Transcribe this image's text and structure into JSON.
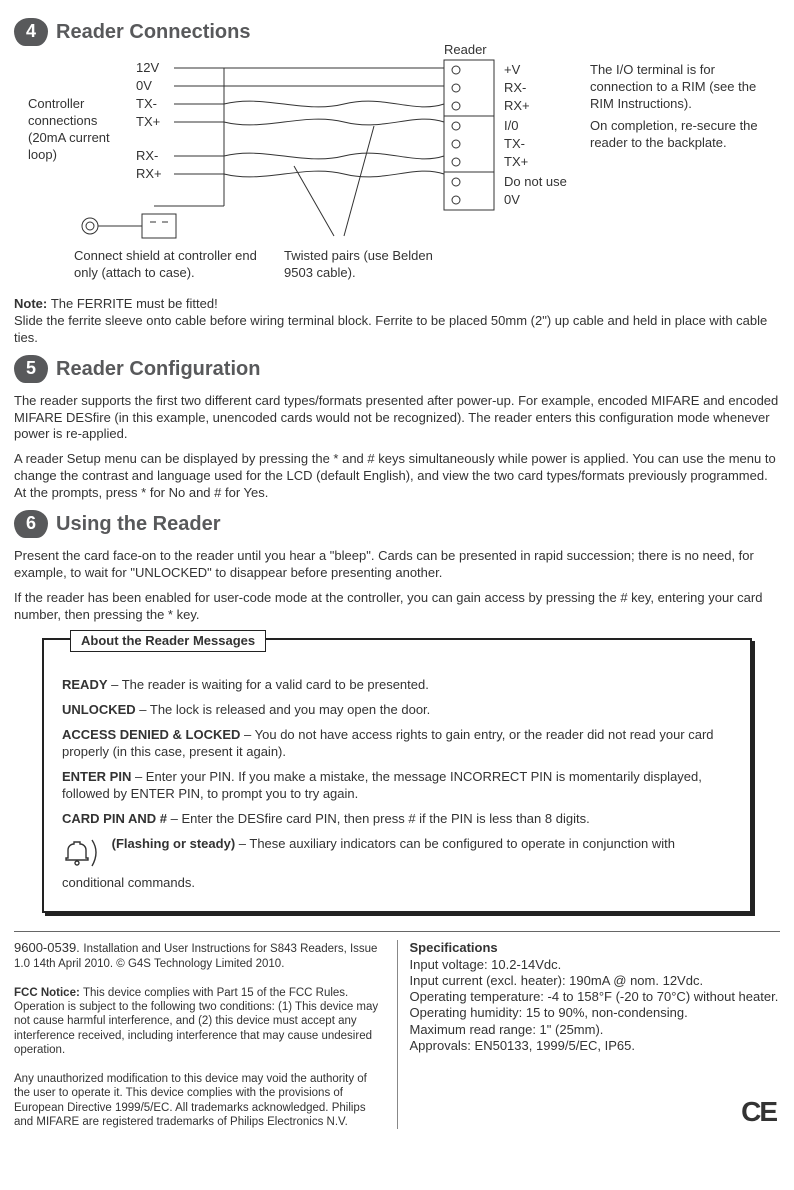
{
  "section4": {
    "num": "4",
    "title": "Reader Connections",
    "diagram": {
      "left_group_label": "Controller connections (20mA current loop)",
      "left_pins": [
        "12V",
        "0V",
        "TX-",
        "TX+",
        "RX-",
        "RX+"
      ],
      "reader_label": "Reader",
      "right_pins": [
        "+V",
        "RX-",
        "RX+",
        "I/0",
        "TX-",
        "TX+",
        "Do not use",
        "0V"
      ],
      "shield_note": "Connect shield at controller end only (attach to case).",
      "twist_note": "Twisted pairs (use Belden 9503 cable).",
      "right_note1": "The I/O terminal is for connection to a RIM (see the RIM Instructions).",
      "right_note2": "On completion, re-secure the reader to the backplate."
    },
    "ferrite_note_lead": "Note: ",
    "ferrite_note_bold": "The FERRITE must be fitted!",
    "ferrite_note_body": "Slide the ferrite sleeve onto cable before wiring terminal block.  Ferrite to be placed 50mm (2\") up cable and held in place with cable ties."
  },
  "section5": {
    "num": "5",
    "title": "Reader Configuration",
    "p1": "The reader supports the first two different card types/formats presented after power-up. For example, encoded MIFARE and encoded MIFARE DESfire (in this example, unencoded cards would not be recognized). The reader enters this configuration mode whenever power is re-applied.",
    "p2": "A reader Setup menu can be displayed by pressing the * and # keys simultaneously while power is applied. You can use the menu to change the contrast and language used for the LCD (default English), and view the two card types/formats previously programmed. At the prompts, press * for No and # for Yes."
  },
  "section6": {
    "num": "6",
    "title": "Using the Reader",
    "p1": "Present the card face-on to the reader until you hear a \"bleep\". Cards can be presented in rapid succession; there is no need, for example, to wait for \"UNLOCKED\" to disappear before presenting another.",
    "p2": "If the reader has been enabled for user-code mode at the controller, you can gain access by pressing the # key, entering your card number, then pressing the * key.",
    "box_title": "About the Reader Messages",
    "msgs": {
      "ready_b": "READY",
      "ready_t": " – The reader is waiting for a valid card to be presented.",
      "unlocked_b": "UNLOCKED",
      "unlocked_t": " – The lock is released and you may open the door.",
      "denied_b": "ACCESS DENIED & LOCKED",
      "denied_t": " – You do not have access rights to gain entry, or the reader did not read your card properly (in this case, present it again).",
      "pin_b": "ENTER PIN",
      "pin_t": " – Enter your PIN. If you make a mistake, the message INCORRECT PIN is momentarily displayed, followed by ENTER PIN, to prompt you to try again.",
      "card_b": "CARD PIN AND #",
      "card_t": " – Enter the DESfire card PIN, then press # if the PIN is less than 8 digits.",
      "flash_b": "(Flashing or steady)",
      "flash_t": " – These auxiliary indicators can be configured to operate in conjunction with conditional commands."
    }
  },
  "footer": {
    "docnum": "9600-0539. ",
    "install": "Installation and User Instructions for S843 Readers, Issue 1.0 14th April 2010. © G4S Technology Limited 2010.",
    "fcc_b": "FCC Notice: ",
    "fcc": "This device complies with Part 15 of the FCC Rules. Operation is subject to the following two conditions: (1) This device may not cause harmful interference, and (2) this device must accept any interference received, including interference that may cause undesired operation.",
    "mod": "Any unauthorized modification to this device may void the authority of the user to operate it. This device complies with the provisions of European Directive 1999/5/EC. All trademarks acknowledged. Philips and MIFARE are registered trademarks of Philips Electronics N.V.",
    "specs_h": "Specifications",
    "specs_lines": [
      "Input voltage: 10.2-14Vdc.",
      "Input current (excl. heater): 190mA @ nom. 12Vdc.",
      "Operating temperature: -4 to 158°F (-20 to 70°C) without heater.",
      "Operating humidity: 15 to 90%, non-condensing.",
      "Maximum read range: 1\" (25mm).",
      "Approvals: EN50133, 1999/5/EC, IP65."
    ]
  }
}
